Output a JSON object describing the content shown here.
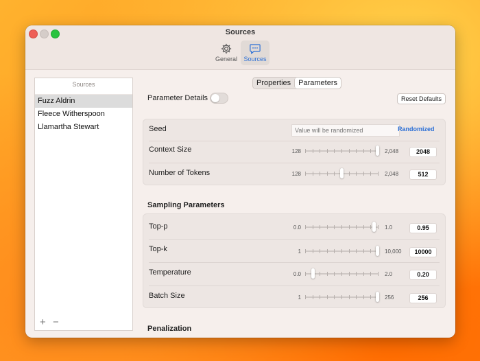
{
  "window": {
    "title": "Sources"
  },
  "toolbar": {
    "general_label": "General",
    "sources_label": "Sources"
  },
  "sidebar": {
    "header": "Sources",
    "items": [
      {
        "label": "Fuzz Aldrin",
        "selected": true
      },
      {
        "label": "Fleece Witherspoon",
        "selected": false
      },
      {
        "label": "Llamartha Stewart",
        "selected": false
      }
    ],
    "add_label": "+",
    "remove_label": "−"
  },
  "tabs": [
    {
      "label": "Properties",
      "active": false
    },
    {
      "label": "Parameters",
      "active": true
    }
  ],
  "parameter_details": {
    "label": "Parameter Details",
    "enabled": false
  },
  "reset_label": "Reset Defaults",
  "group1": {
    "seed": {
      "label": "Seed",
      "placeholder": "Value will be randomized",
      "badge": "Randomized"
    },
    "context_size": {
      "label": "Context Size",
      "min": "128",
      "max": "2,048",
      "value": "2048",
      "position": 1.0
    },
    "tokens": {
      "label": "Number of Tokens",
      "min": "128",
      "max": "2,048",
      "value": "512",
      "position": 0.5
    }
  },
  "sampling": {
    "title": "Sampling Parameters",
    "top_p": {
      "label": "Top-p",
      "min": "0.0",
      "max": "1.0",
      "value": "0.95",
      "position": 0.95
    },
    "top_k": {
      "label": "Top-k",
      "min": "1",
      "max": "10,000",
      "value": "10000",
      "position": 1.0
    },
    "temperature": {
      "label": "Temperature",
      "min": "0.0",
      "max": "2.0",
      "value": "0.20",
      "position": 0.1
    },
    "batch": {
      "label": "Batch Size",
      "min": "1",
      "max": "256",
      "value": "256",
      "position": 1.0
    }
  },
  "penalization": {
    "title": "Penalization"
  },
  "colors": {
    "accent": "#2b6fd6",
    "window_bg": "#f6efec",
    "close": "#ee5f57",
    "zoom": "#29c33f"
  },
  "icons": {
    "general": "gear-icon",
    "sources": "chat-bubble-icon"
  }
}
